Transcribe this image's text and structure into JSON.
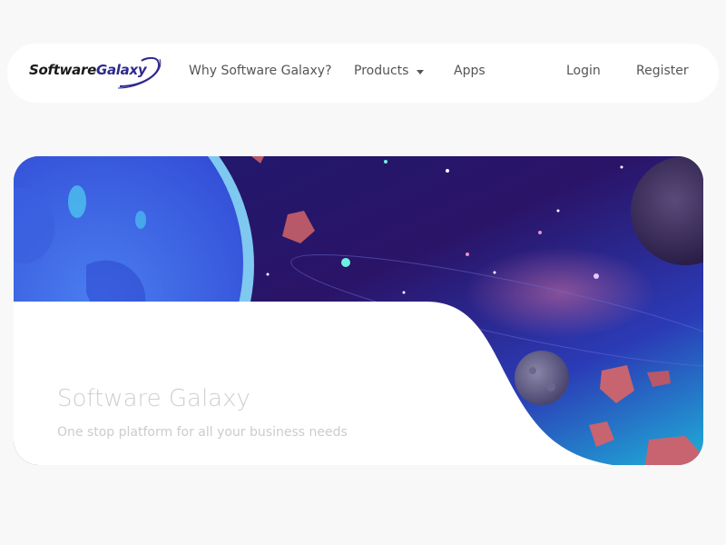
{
  "brand": {
    "logo_main": "Software",
    "logo_accent": "Galaxy",
    "accent_color": "#2e2a8c"
  },
  "nav": {
    "items": [
      {
        "label": "Why Software Galaxy?"
      },
      {
        "label": "Products"
      },
      {
        "label": "Apps"
      }
    ],
    "login_label": "Login",
    "register_label": "Register"
  },
  "hero": {
    "title": "Software Galaxy",
    "subtitle": "One stop platform for all your business needs",
    "icons": {
      "dropdown": "caret-down-icon"
    }
  }
}
